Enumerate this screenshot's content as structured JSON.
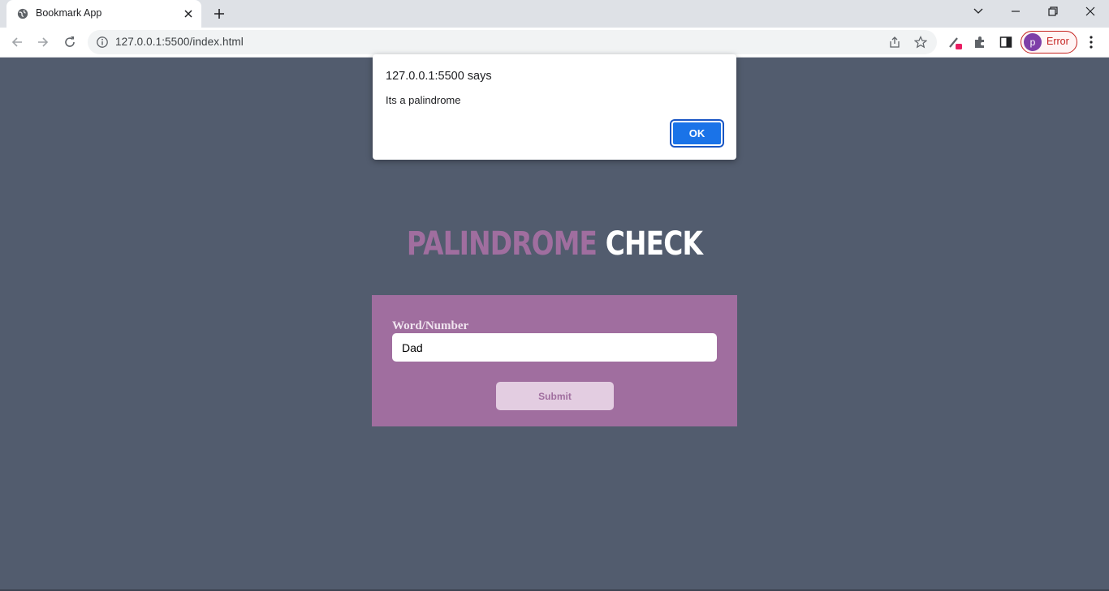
{
  "browser": {
    "tab": {
      "title": "Bookmark App",
      "favicon": "globe-icon"
    },
    "address_bar": {
      "url": "127.0.0.1:5500/index.html"
    },
    "profile": {
      "initial": "p",
      "status": "Error"
    }
  },
  "page": {
    "heading": {
      "word1": "PALINDROME",
      "word2": "CHECK"
    },
    "form": {
      "label": "Word/Number",
      "input_value": "Dad",
      "submit_label": "Submit"
    }
  },
  "dialog": {
    "title": "127.0.0.1:5500 says",
    "message": "Its a palindrome",
    "ok_label": "OK"
  },
  "colors": {
    "page_background": "#525c6e",
    "accent_purple": "#a06e9f",
    "button_light": "#e3cde1",
    "dialog_button": "#1a73e8"
  }
}
